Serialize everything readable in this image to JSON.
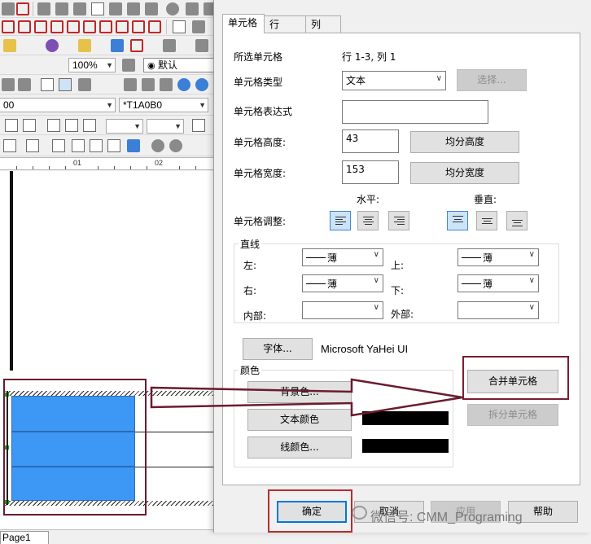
{
  "editor": {
    "zoom_value": "100%",
    "style_value": "默认",
    "font_size_value": "00",
    "cell_name_value": "*T1A0B0",
    "ruler_marks": [
      "01",
      "02"
    ],
    "page_tab": "Page1"
  },
  "dialog": {
    "tabs": [
      {
        "label": "单元格"
      },
      {
        "label": "行"
      },
      {
        "label": "列"
      }
    ],
    "selected_cells_label": "所选单元格",
    "selected_cells_value": "行 1-3, 列 1",
    "cell_type_label": "单元格类型",
    "cell_type_value": "文本",
    "select_button": "选择...",
    "cell_expr_label": "单元格表达式",
    "cell_expr_value": "",
    "cell_height_label": "单元格高度:",
    "cell_height_value": "43",
    "equal_height_button": "均分高度",
    "cell_width_label": "单元格宽度:",
    "cell_width_value": "153",
    "equal_width_button": "均分宽度",
    "horizontal_label": "水平:",
    "vertical_label": "垂直:",
    "cell_adjust_label": "单元格调整:",
    "lines_group_title": "直线",
    "left_label": "左:",
    "left_value": "薄",
    "top_label": "上:",
    "top_value": "薄",
    "right_label": "右:",
    "right_value": "薄",
    "bottom_label": "下:",
    "bottom_value": "薄",
    "inner_label": "内部:",
    "inner_value": "",
    "outer_label": "外部:",
    "outer_value": "",
    "font_button": "字体...",
    "font_name": "Microsoft YaHei UI",
    "color_group_title": "颜色",
    "bg_color_button": "背景色...",
    "text_color_button": "文本颜色",
    "line_color_button": "线颜色...",
    "text_color_swatch": "#000000",
    "line_color_swatch": "#000000",
    "merge_button": "合并单元格",
    "split_button": "拆分单元格",
    "ok_button": "确定",
    "cancel_button": "取消",
    "apply_button": "应用",
    "help_button": "帮助"
  },
  "watermark": {
    "text": "微信号: CMM_Programing"
  },
  "colors": {
    "cell_blue": "#3d97f5",
    "highlight_red": "#b82c2c",
    "highlight_dark": "#6b1b2f"
  }
}
